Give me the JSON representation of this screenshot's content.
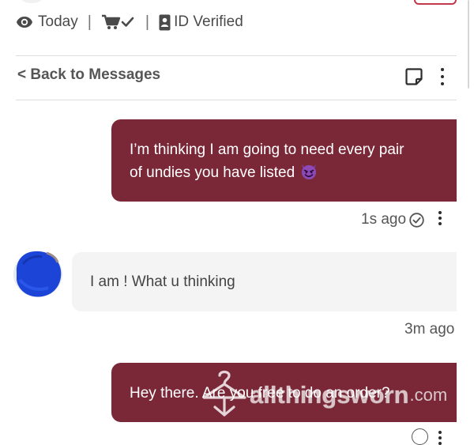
{
  "header": {
    "seen_label": "Today",
    "verified_label": "ID Verified"
  },
  "nav": {
    "back_label": "< Back to Messages"
  },
  "messages": [
    {
      "direction": "outgoing",
      "text": "I’m thinking I am going to need every pair of undies you have listed",
      "emoji": "smiling-devil-emoji",
      "time": "1s ago"
    },
    {
      "direction": "incoming",
      "text": "I am ! What u thinking",
      "time": "3m ago"
    },
    {
      "direction": "outgoing",
      "text": "Hey there. Are you free to do an order?"
    }
  ],
  "watermark": {
    "text": "allthingsworn",
    "suffix": ".com"
  },
  "colors": {
    "outgoing_bubble": "#7a2838",
    "incoming_bubble": "#f4f4f4",
    "accent_border": "#c2394e",
    "divider": "#dddddd"
  },
  "icons": [
    "eye-icon",
    "cart-check-icon",
    "id-card-icon",
    "note-icon",
    "more-vertical-icon",
    "check-circle-icon",
    "hanger-icon"
  ]
}
